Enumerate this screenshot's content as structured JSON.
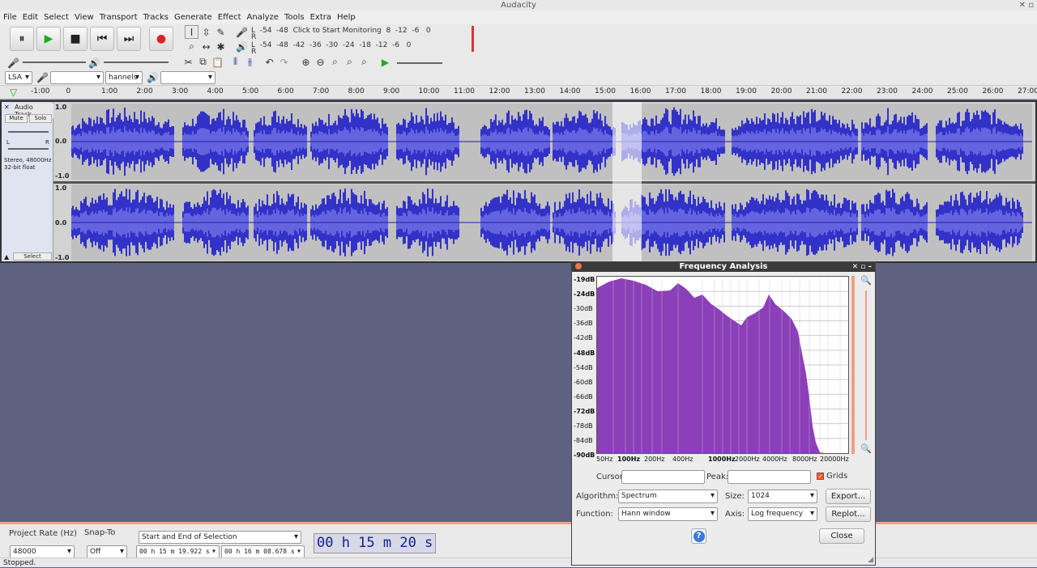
{
  "window": {
    "title": "Audacity"
  },
  "menu": [
    "File",
    "Edit",
    "Select",
    "View",
    "Transport",
    "Tracks",
    "Generate",
    "Effect",
    "Analyze",
    "Tools",
    "Extra",
    "Help"
  ],
  "meter": {
    "record_scale": "L  -54  -48  Click to Start Monitoring  8  -12  -6   0",
    "record_r": "R",
    "playback_scale": "L  -54  -48  -42  -36  -30  -24  -18  -12  -6   0",
    "playback_r": "R"
  },
  "device": {
    "host": "LSA",
    "channels": "hannels"
  },
  "ruler": [
    "-1:00",
    "0",
    "1:00",
    "2:00",
    "3:00",
    "4:00",
    "5:00",
    "6:00",
    "7:00",
    "8:00",
    "9:00",
    "10:00",
    "11:00",
    "12:00",
    "13:00",
    "14:00",
    "15:00",
    "16:00",
    "17:00",
    "18:00",
    "19:00",
    "20:00",
    "21:00",
    "22:00",
    "23:00",
    "24:00",
    "25:00",
    "26:00",
    "27:00"
  ],
  "track": {
    "name": "Audio Track",
    "mute": "Mute",
    "solo": "Solo",
    "left": "L",
    "right": "R",
    "info1": "Stereo, 48000Hz",
    "info2": "32-bit float",
    "select": "Select",
    "scale": [
      "1.0",
      "0.0",
      "-1.0"
    ]
  },
  "bottom": {
    "rate_label": "Project Rate (Hz)",
    "rate_value": "48000",
    "snap_label": "Snap-To",
    "snap_value": "Off",
    "sel_mode": "Start and End of Selection",
    "sel_start": "00 h 15 m 19.922 s",
    "sel_end": "00 h 16 m 08.678 s",
    "time": "00 h 15 m 20 s"
  },
  "status": "Stopped.",
  "fa": {
    "title": "Frequency Analysis",
    "db": [
      "-19dB",
      "-24dB",
      "-30dB",
      "-36dB",
      "-42dB",
      "-48dB",
      "-54dB",
      "-60dB",
      "-66dB",
      "-72dB",
      "-78dB",
      "-84dB",
      "-90dB"
    ],
    "hz": [
      "50Hz",
      "100Hz",
      "200Hz",
      "400Hz",
      "1000Hz",
      "2000Hz",
      "4000Hz",
      "8000Hz",
      "20000Hz"
    ],
    "cursor_label": "Cursor:",
    "peak_label": "Peak:",
    "grids_label": "Grids",
    "algorithm_label": "Algorithm:",
    "algorithm_value": "Spectrum",
    "size_label": "Size:",
    "size_value": "1024",
    "function_label": "Function:",
    "function_value": "Hann window",
    "axis_label": "Axis:",
    "axis_value": "Log frequency",
    "export": "Export...",
    "replot": "Replot...",
    "close": "Close",
    "help": "?"
  },
  "colors": {
    "wave": "#3232c8",
    "spectrum": "#8b3fb8"
  }
}
